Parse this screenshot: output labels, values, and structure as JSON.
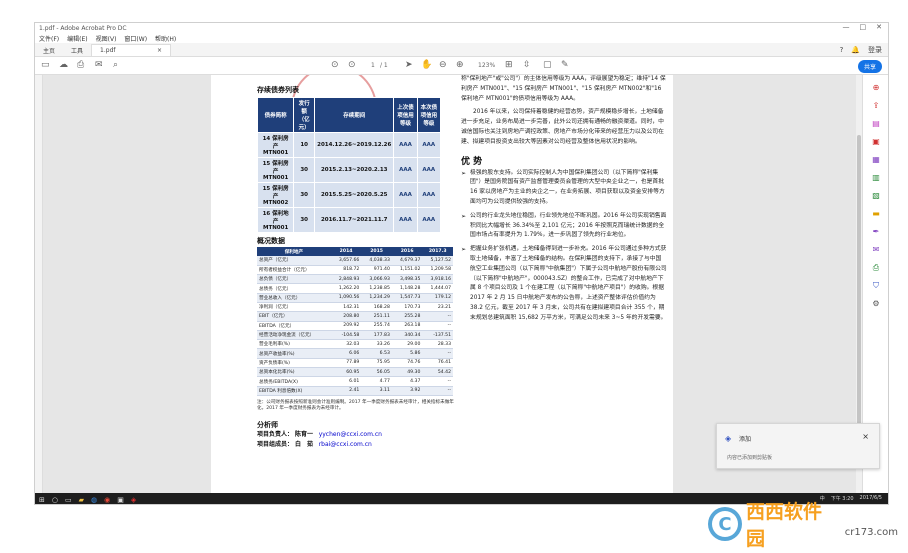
{
  "window": {
    "title": "1.pdf - Adobe Acrobat Pro DC",
    "min": "—",
    "max": "□",
    "close": "✕"
  },
  "menu": [
    "文件(F)",
    "编辑(E)",
    "视图(V)",
    "窗口(W)",
    "帮助(H)"
  ],
  "tabs": {
    "home": "主页",
    "tools": "工具",
    "doc": "1.pdf",
    "close": "×"
  },
  "topright": {
    "help": "?",
    "bell": "🔔",
    "login": "登录"
  },
  "toolbar": {
    "page": "1",
    "pages": "/ 1",
    "zoom": "123%",
    "share": "共享"
  },
  "left": {
    "bond_title": "存续债券列表",
    "bond_headers": [
      "债券简称",
      "发行额（亿元）",
      "存续期间",
      "上次债项信用等级",
      "本次债项信用等级"
    ],
    "bonds": [
      [
        "14 保利房产 MTN001",
        "10",
        "2014.12.26~2019.12.26",
        "AAA",
        "AAA"
      ],
      [
        "15 保利房产 MTN001",
        "30",
        "2015.2.13~2020.2.13",
        "AAA",
        "AAA"
      ],
      [
        "15 保利房产 MTN002",
        "30",
        "2015.5.25~2020.5.25",
        "AAA",
        "AAA"
      ],
      [
        "16 保利地产 MTN001",
        "30",
        "2016.11.7~2021.11.7",
        "AAA",
        "AAA"
      ]
    ],
    "overview_title": "概况数据",
    "ov_headers": [
      "保利地产",
      "2014",
      "2015",
      "2016",
      "2017.3"
    ],
    "overview": [
      [
        "总资产（亿元）",
        "3,657.66",
        "4,038.33",
        "4,679.37",
        "5,127.52"
      ],
      [
        "所有者权益合计（亿元）",
        "818.72",
        "971.40",
        "1,151.02",
        "1,209.58"
      ],
      [
        "总负债（亿元）",
        "2,848.93",
        "3,066.93",
        "3,498.35",
        "3,918.16"
      ],
      [
        "总债务（亿元）",
        "1,262.20",
        "1,238.85",
        "1,148.28",
        "1,444.07"
      ],
      [
        "营业总收入（亿元）",
        "1,090.56",
        "1,234.29",
        "1,547.73",
        "179.12"
      ],
      [
        "净利润（亿元）",
        "142.31",
        "168.28",
        "170.73",
        "23.21"
      ],
      [
        "EBIT（亿元）",
        "208.80",
        "251.11",
        "255.28",
        "--"
      ],
      [
        "EBITDA（亿元）",
        "209.92",
        "255.74",
        "263.18",
        "--"
      ],
      [
        "经营活动净现金流（亿元）",
        "-104.58",
        "177.83",
        "340.34",
        "-137.51"
      ],
      [
        "营业毛利率(%)",
        "32.03",
        "33.26",
        "29.00",
        "28.33"
      ],
      [
        "总资产收益率(%)",
        "6.06",
        "6.53",
        "5.86",
        "--"
      ],
      [
        "资产负债率(%)",
        "77.89",
        "75.95",
        "74.76",
        "76.41"
      ],
      [
        "总资本化比率(%)",
        "60.95",
        "56.05",
        "49.30",
        "54.42"
      ],
      [
        "总债务/EBITDA(X)",
        "6.01",
        "4.77",
        "4.37",
        "--"
      ],
      [
        "EBITDA 利息倍数(X)",
        "2.41",
        "3.11",
        "3.92",
        "--"
      ]
    ],
    "note": "注：公司财务报表按照新准则会计准则编制。2017 年一季度财务报表未经审计，相关指标未做年化，2017 年一季度财务报表为未经审计。",
    "analyst_title": "分析师",
    "analysts": [
      {
        "role": "项目负责人：",
        "name": "陈育一",
        "email": "yychen@ccxi.com.cn"
      },
      {
        "role": "项目组成员：",
        "name": "白　茹",
        "email": "rbai@ccxi.com.cn"
      }
    ]
  },
  "right": {
    "p1": "称\"保利地产\"或\"公司\"）的主体信用等级为 AAA，评级展望为稳定；维持\"14 保利房产 MTN001\"、\"15 保利房产 MTN001\"、\"15 保利房产 MTN002\"和\"16 保利地产 MTN001\"的债项信用等级为 AAA。",
    "p2": "2016 年以来，公司保持着稳健的经营态势，资产规模稳步增长，土地储备进一步充足，业务布局进一步完善，此外公司还拥有通畅的融资渠道。同时，中诚信国际也关注到房地产调控政策、房地产市场分化带来的经营压力以及公司在建、拟建项目投资支出较大等因素对公司经营及整体信用状况的影响。",
    "adv_title": "优 势",
    "b1": "极强的股东支持。公司实际控制人为中国保利集团公司（以下简称\"保利集团\"）是国务院国有资产监督管理委员会管理的大型中央企业之一，也是首批 16 家以房地产为主业的央企之一，在业务拓展、项目获取以及资金安排等方面均可为公司提供较强的支持。",
    "b2": "公司的行业龙头地位稳固，行业领先地位不断巩固。2016 年公司实现销售面积同比大幅增长 36.34%至 2,101 亿元；2016 年按照克而瑞统计数据的全国市场占有率提升为 1.79%，进一步巩固了领先的行业地位。",
    "b3": "把握业务扩张机遇，土地储备得到进一步补充。2016 年公司通过多种方式获取土地储备，丰富了土地储备的结构。在保利集团的支持下，承接了与中国航空工业集团公司（以下简称\"中航集团\"）下属子公司中航地产股份有限公司（以下简称\"中航地产\"，000043.SZ）的整合工作，已完成了对中航地产下属 8 个项目公司及 1 个在建工程（以下简称\"中航地产项目\"）的收购。根据 2017 年 2 月 15 日中航地产发布的公告称，上述资产整体评估价值约为 38.2 亿元，截至 2017 年 3 月末，公司共有在建拟建项目合计 355 个，期末规划总建筑面积 15,682 万平方米，可满足公司未来 3~5 年的开发需要。"
  },
  "toast": {
    "title": "添加",
    "body": "内容已添加到剪贴板",
    "close": "×"
  },
  "taskbar": {
    "time": "下午 3:20",
    "date": "2017/6/5",
    "lang": "中"
  },
  "watermark": {
    "logo": "C",
    "name": "西西软件园",
    "domain": "cr173.com"
  }
}
